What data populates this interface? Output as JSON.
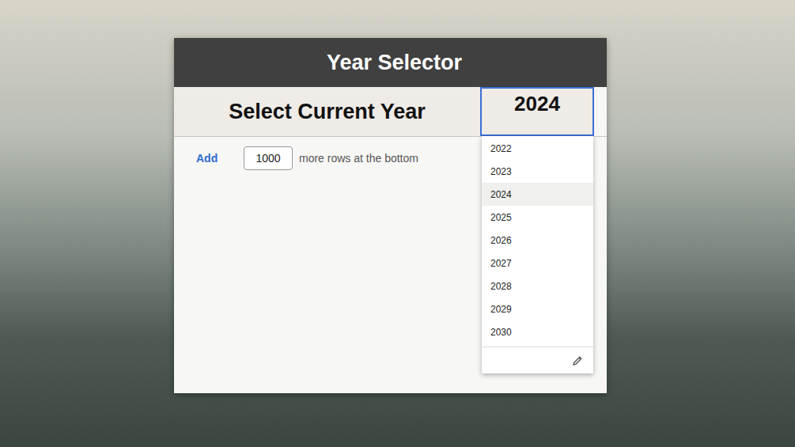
{
  "window": {
    "title": "Year Selector"
  },
  "row": {
    "label": "Select Current Year",
    "value": "2024"
  },
  "add_rows": {
    "link": "Add",
    "count": "1000",
    "suffix": "more rows at the bottom"
  },
  "dropdown": {
    "options": [
      {
        "label": "2022",
        "selected": false
      },
      {
        "label": "2023",
        "selected": false
      },
      {
        "label": "2024",
        "selected": true
      },
      {
        "label": "2025",
        "selected": false
      },
      {
        "label": "2026",
        "selected": false
      },
      {
        "label": "2027",
        "selected": false
      },
      {
        "label": "2028",
        "selected": false
      },
      {
        "label": "2029",
        "selected": false
      },
      {
        "label": "2030",
        "selected": false
      }
    ]
  }
}
